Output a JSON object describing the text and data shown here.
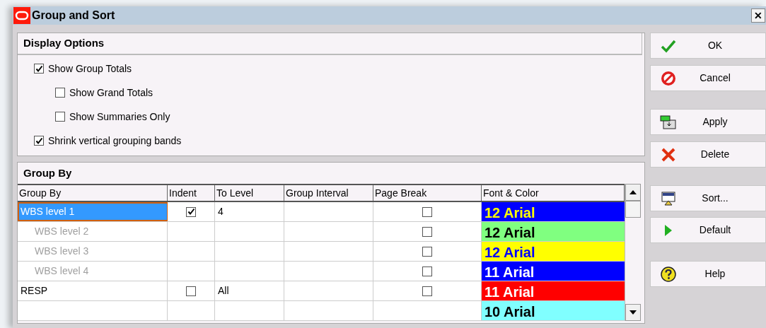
{
  "window": {
    "title": "Group and Sort",
    "close": "✕"
  },
  "display_options": {
    "title": "Display Options",
    "options": [
      {
        "label": "Show Group Totals",
        "checked": true,
        "nested": false
      },
      {
        "label": "Show Grand Totals",
        "checked": false,
        "nested": true
      },
      {
        "label": "Show Summaries Only",
        "checked": false,
        "nested": true
      },
      {
        "label": "Shrink vertical grouping bands",
        "checked": true,
        "nested": false
      }
    ]
  },
  "group_by": {
    "title": "Group By",
    "columns": [
      "Group By",
      "Indent",
      "To Level",
      "Group Interval",
      "Page Break",
      "Font & Color"
    ],
    "rows": [
      {
        "group_by": "WBS level 1",
        "selected": true,
        "disabled": false,
        "indent": true,
        "to_level": "4",
        "page_break": false,
        "color": "#0000ff",
        "font": {
          "label": "12 Arial",
          "color": "#ffff00"
        }
      },
      {
        "group_by": "WBS level 2",
        "selected": false,
        "disabled": true,
        "page_break": false,
        "color": "#80ff80",
        "font": {
          "label": "12 Arial",
          "color": "#000000"
        }
      },
      {
        "group_by": "WBS level 3",
        "selected": false,
        "disabled": true,
        "page_break": false,
        "color": "#ffff00",
        "font": {
          "label": "12 Arial",
          "color": "#0000ff"
        }
      },
      {
        "group_by": "WBS level 4",
        "selected": false,
        "disabled": true,
        "page_break": false,
        "color": "#0000ff",
        "font": {
          "label": "11 Arial",
          "color": "#ffffff"
        }
      },
      {
        "group_by": "RESP",
        "selected": false,
        "disabled": false,
        "indent": false,
        "to_level": "All",
        "page_break": false,
        "color": "#ff0000",
        "font": {
          "label": "11 Arial",
          "color": "#ffffff"
        }
      },
      {
        "color": "#80ffff",
        "font": {
          "label": "10 Arial",
          "color": "#000000"
        }
      }
    ]
  },
  "buttons": [
    {
      "label": "OK",
      "kind": "ok"
    },
    {
      "label": "Cancel",
      "kind": "cancel"
    },
    {
      "label": "Apply",
      "kind": "apply"
    },
    {
      "label": "Delete",
      "kind": "delete"
    },
    {
      "label": "Sort...",
      "kind": "sort"
    },
    {
      "label": "Default",
      "kind": "default"
    },
    {
      "label": "Help",
      "kind": "help"
    }
  ]
}
